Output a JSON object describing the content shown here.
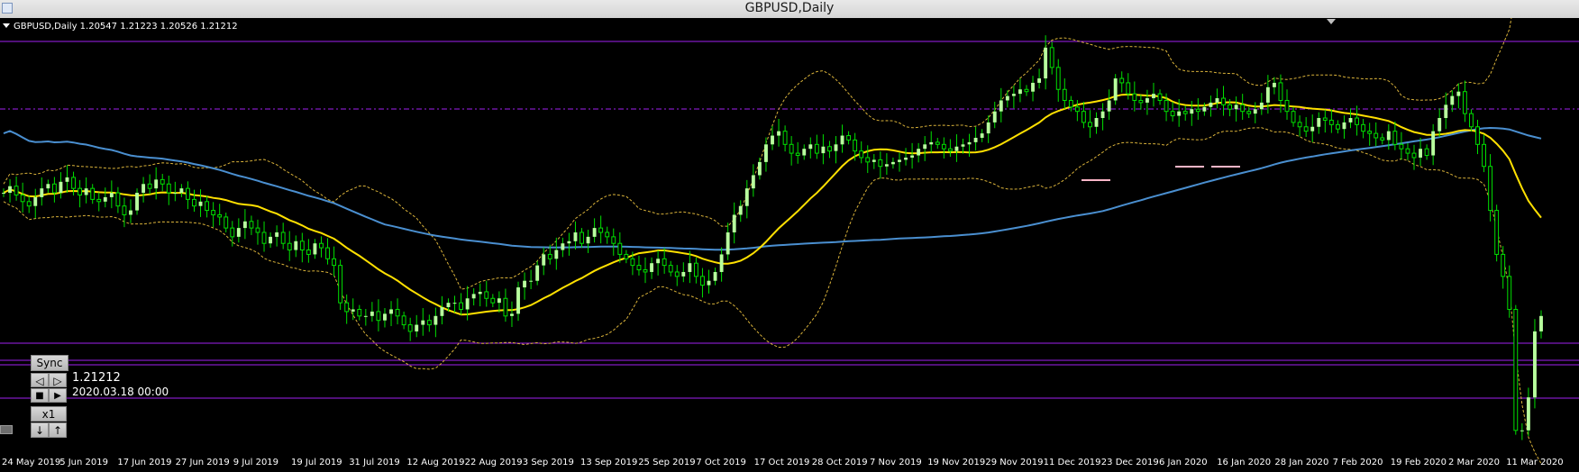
{
  "window": {
    "title": "GBPUSD,Daily"
  },
  "header": {
    "symbol_line": "GBPUSD,Daily  1.20547 1.21223 1.20526 1.21212"
  },
  "sync_panel": {
    "sync_label": "Sync",
    "prev_glyph": "◁",
    "next_glyph": "▷",
    "stop_glyph": "■",
    "play_glyph": "▶",
    "speed_label": "x1",
    "down_glyph": "↓",
    "up_glyph": "↑",
    "price": "1.21212",
    "datetime": "2020.03.18 00:00"
  },
  "colors": {
    "background": "#000000",
    "bull_candle": "#b8ff9e",
    "wick": "#00e000",
    "ma_short": "#ffe000",
    "ma_long": "#4a8fd0",
    "bands": "#d9b23a",
    "levels": "#a020f0",
    "marks": "#ffb6c8"
  },
  "chart_data": {
    "type": "candlestick",
    "x_tick_labels": [
      "24 May 2019",
      "5 Jun 2019",
      "17 Jun 2019",
      "27 Jun 2019",
      "9 Jul 2019",
      "19 Jul 2019",
      "31 Jul 2019",
      "12 Aug 2019",
      "22 Aug 2019",
      "3 Sep 2019",
      "13 Sep 2019",
      "25 Sep 2019",
      "7 Oct 2019",
      "17 Oct 2019",
      "28 Oct 2019",
      "7 Nov 2019",
      "19 Nov 2019",
      "29 Nov 2019",
      "11 Dec 2019",
      "23 Dec 2019",
      "6 Jan 2020",
      "16 Jan 2020",
      "28 Jan 2020",
      "7 Feb 2020",
      "19 Feb 2020",
      "2 Mar 2020",
      "11 Mar 2020"
    ],
    "last_bar": {
      "open": 1.20547,
      "high": 1.21223,
      "low": 1.20526,
      "close": 1.21212
    },
    "close_series": [
      1.268,
      1.271,
      1.267,
      1.264,
      1.262,
      1.266,
      1.27,
      1.272,
      1.268,
      1.273,
      1.275,
      1.27,
      1.267,
      1.27,
      1.265,
      1.264,
      1.266,
      1.268,
      1.262,
      1.258,
      1.26,
      1.268,
      1.272,
      1.27,
      1.274,
      1.272,
      1.268,
      1.268,
      1.27,
      1.265,
      1.262,
      1.264,
      1.26,
      1.258,
      1.257,
      1.252,
      1.248,
      1.252,
      1.255,
      1.252,
      1.25,
      1.245,
      1.248,
      1.25,
      1.245,
      1.242,
      1.246,
      1.242,
      1.24,
      1.245,
      1.243,
      1.238,
      1.235,
      1.218,
      1.214,
      1.215,
      1.212,
      1.212,
      1.214,
      1.21,
      1.213,
      1.215,
      1.212,
      1.208,
      1.205,
      1.208,
      1.21,
      1.208,
      1.212,
      1.216,
      1.218,
      1.218,
      1.215,
      1.22,
      1.222,
      1.223,
      1.22,
      1.218,
      1.22,
      1.212,
      1.213,
      1.225,
      1.228,
      1.228,
      1.235,
      1.24,
      1.238,
      1.242,
      1.245,
      1.246,
      1.25,
      1.245,
      1.248,
      1.252,
      1.25,
      1.248,
      1.245,
      1.24,
      1.238,
      1.235,
      1.233,
      1.232,
      1.236,
      1.238,
      1.235,
      1.232,
      1.23,
      1.232,
      1.236,
      1.23,
      1.226,
      1.228,
      1.232,
      1.24,
      1.25,
      1.258,
      1.262,
      1.27,
      1.276,
      1.282,
      1.29,
      1.294,
      1.296,
      1.29,
      1.286,
      1.285,
      1.288,
      1.29,
      1.286,
      1.289,
      1.287,
      1.29,
      1.294,
      1.292,
      1.287,
      1.284,
      1.282,
      1.283,
      1.28,
      1.281,
      1.282,
      1.283,
      1.284,
      1.285,
      1.288,
      1.29,
      1.291,
      1.29,
      1.288,
      1.287,
      1.289,
      1.29,
      1.291,
      1.293,
      1.295,
      1.3,
      1.305,
      1.31,
      1.312,
      1.313,
      1.315,
      1.314,
      1.318,
      1.32,
      1.334,
      1.325,
      1.315,
      1.31,
      1.307,
      1.305,
      1.3,
      1.298,
      1.302,
      1.305,
      1.31,
      1.32,
      1.318,
      1.313,
      1.31,
      1.309,
      1.311,
      1.313,
      1.31,
      1.305,
      1.303,
      1.305,
      1.304,
      1.306,
      1.305,
      1.307,
      1.309,
      1.311,
      1.308,
      1.306,
      1.308,
      1.305,
      1.304,
      1.306,
      1.309,
      1.316,
      1.318,
      1.31,
      1.305,
      1.3,
      1.298,
      1.296,
      1.298,
      1.302,
      1.301,
      1.299,
      1.297,
      1.3,
      1.302,
      1.299,
      1.296,
      1.295,
      1.293,
      1.292,
      1.296,
      1.29,
      1.288,
      1.286,
      1.284,
      1.288,
      1.285,
      1.296,
      1.302,
      1.308,
      1.312,
      1.314,
      1.304,
      1.298,
      1.29,
      1.28,
      1.26,
      1.24,
      1.23,
      1.215,
      1.16,
      1.16,
      1.175,
      1.205,
      1.212
    ]
  }
}
